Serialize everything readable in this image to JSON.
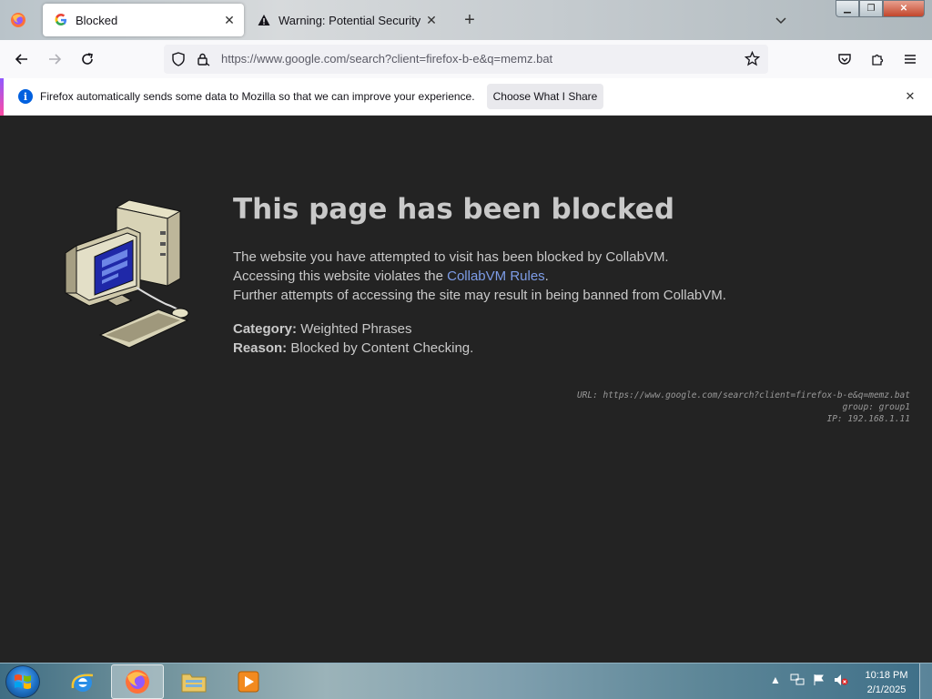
{
  "browser": {
    "tabs": [
      {
        "title": "Blocked",
        "active": true,
        "favicon": "google-g-icon"
      },
      {
        "title": "Warning: Potential Security Risk",
        "active": false,
        "favicon": "warning-triangle-icon"
      }
    ],
    "url": "https://www.google.com/search?client=firefox-b-e&q=memz.bat"
  },
  "notification": {
    "text": "Firefox automatically sends some data to Mozilla so that we can improve your experience.",
    "button_label": "Choose What I Share"
  },
  "page": {
    "title": "This page has been blocked",
    "line1": "The website you have attempted to visit has been blocked by CollabVM.",
    "line2_prefix": "Accessing this website violates the ",
    "line2_link": "CollabVM Rules",
    "line2_suffix": ".",
    "line3": "Further attempts of accessing the site may result in being banned from CollabVM.",
    "category_label": "Category:",
    "category_value": "Weighted Phrases",
    "reason_label": "Reason:",
    "reason_value": "Blocked by Content Checking.",
    "meta_url": "URL: https://www.google.com/search?client=firefox-b-e&q=memz.bat",
    "meta_group": "group: group1",
    "meta_ip": "IP: 192.168.1.11"
  },
  "taskbar": {
    "time": "10:18 PM",
    "date": "2/1/2025"
  },
  "colors": {
    "page_bg": "#232323",
    "text": "#c9c9c9",
    "link": "#7d9ce6",
    "notify_accent": "#9059ff"
  }
}
